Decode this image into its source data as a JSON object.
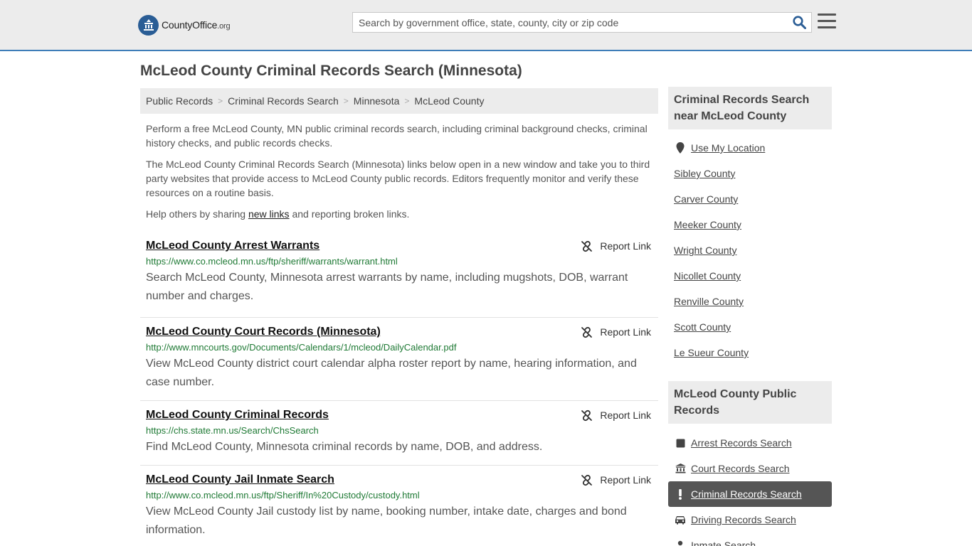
{
  "header": {
    "logo_name": "CountyOffice",
    "logo_tld": ".org",
    "search_placeholder": "Search by government office, state, county, city or zip code"
  },
  "page": {
    "title": "McLeod County Criminal Records Search (Minnesota)"
  },
  "breadcrumb": [
    "Public Records",
    "Criminal Records Search",
    "Minnesota",
    "McLeod County"
  ],
  "intro": {
    "p1": "Perform a free McLeod County, MN public criminal records search, including criminal background checks, criminal history checks, and public records checks.",
    "p2": "The McLeod County Criminal Records Search (Minnesota) links below open in a new window and take you to third party websites that provide access to McLeod County public records. Editors frequently monitor and verify these resources on a routine basis.",
    "p3_pre": "Help others by sharing ",
    "p3_link": "new links",
    "p3_post": " and reporting broken links."
  },
  "report_label": "Report Link",
  "results": [
    {
      "title": "McLeod County Arrest Warrants",
      "url": "https://www.co.mcleod.mn.us/ftp/sheriff/warrants/warrant.html",
      "desc": "Search McLeod County, Minnesota arrest warrants by name, including mugshots, DOB, warrant number and charges."
    },
    {
      "title": "McLeod County Court Records (Minnesota)",
      "url": "http://www.mncourts.gov/Documents/Calendars/1/mcleod/DailyCalendar.pdf",
      "desc": "View McLeod County district court calendar alpha roster report by name, hearing information, and case number."
    },
    {
      "title": "McLeod County Criminal Records",
      "url": "https://chs.state.mn.us/Search/ChsSearch",
      "desc": "Find McLeod County, Minnesota criminal records by name, DOB, and address."
    },
    {
      "title": "McLeod County Jail Inmate Search",
      "url": "http://www.co.mcleod.mn.us/ftp/Sheriff/In%20Custody/custody.html",
      "desc": "View McLeod County Jail custody list by name, booking number, intake date, charges and bond information."
    }
  ],
  "sidebar": {
    "nearby_heading": "Criminal Records Search near McLeod County",
    "nearby": [
      {
        "label": "Use My Location",
        "icon": "map-pin-icon"
      },
      {
        "label": "Sibley County"
      },
      {
        "label": "Carver County"
      },
      {
        "label": "Meeker County"
      },
      {
        "label": "Wright County"
      },
      {
        "label": "Nicollet County"
      },
      {
        "label": "Renville County"
      },
      {
        "label": "Scott County"
      },
      {
        "label": "Le Sueur County"
      }
    ],
    "public_heading": "McLeod County Public Records",
    "public": [
      {
        "label": "Arrest Records Search",
        "icon": "square-icon"
      },
      {
        "label": "Court Records Search",
        "icon": "courthouse-icon"
      },
      {
        "label": "Criminal Records Search",
        "icon": "exclamation-icon",
        "active": true
      },
      {
        "label": "Driving Records Search",
        "icon": "car-icon"
      },
      {
        "label": "Inmate Search",
        "icon": "inmate-icon"
      }
    ]
  },
  "colors": {
    "header_bg": "#ececec",
    "header_border": "#3e7db8",
    "url_green": "#1f7a35",
    "active_bg": "#555555"
  }
}
